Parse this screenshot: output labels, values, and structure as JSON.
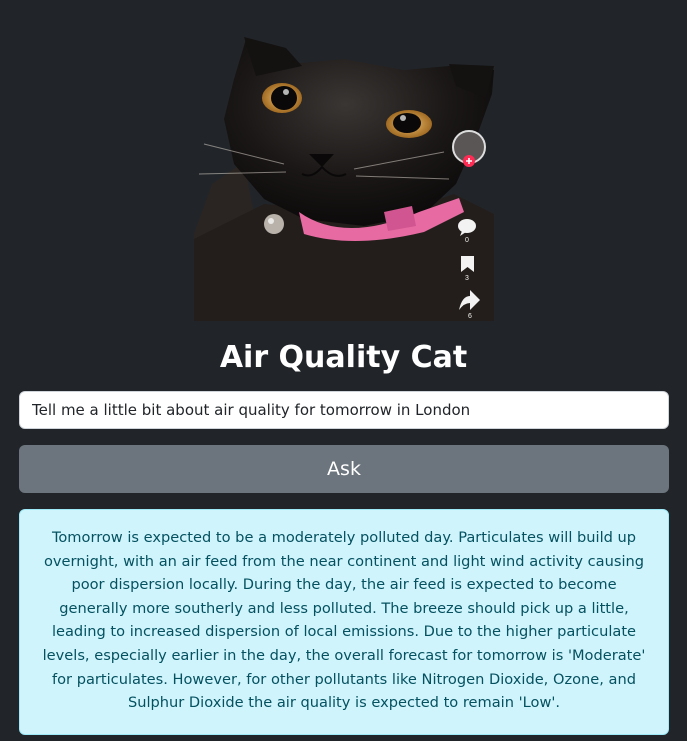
{
  "image": {
    "description_icon": "cat-photo",
    "overlay_counts": {
      "comments": "0",
      "saves": "3",
      "shares": "6"
    }
  },
  "title": "Air Quality Cat",
  "input": {
    "value": "Tell me a little bit about air quality for tomorrow in London"
  },
  "ask_button": {
    "label": "Ask"
  },
  "answer": {
    "text": "Tomorrow is expected to be a moderately polluted day. Particulates will build up overnight, with an air feed from the near continent and light wind activity causing poor dispersion locally. During the day, the air feed is expected to become generally more southerly and less polluted. The breeze should pick up a little, leading to increased dispersion of local emissions. Due to the higher particulate levels, especially earlier in the day, the overall forecast for tomorrow is 'Moderate' for particulates. However, for other pollutants like Nitrogen Dioxide, Ozone, and Sulphur Dioxide the air quality is expected to remain 'Low'."
  },
  "colors": {
    "background": "#212529",
    "button": "#6c757d",
    "alert_bg": "#cff4fc",
    "alert_text": "#055160",
    "collar": "#e86aa2",
    "cat_eye": "#d8a04a"
  }
}
